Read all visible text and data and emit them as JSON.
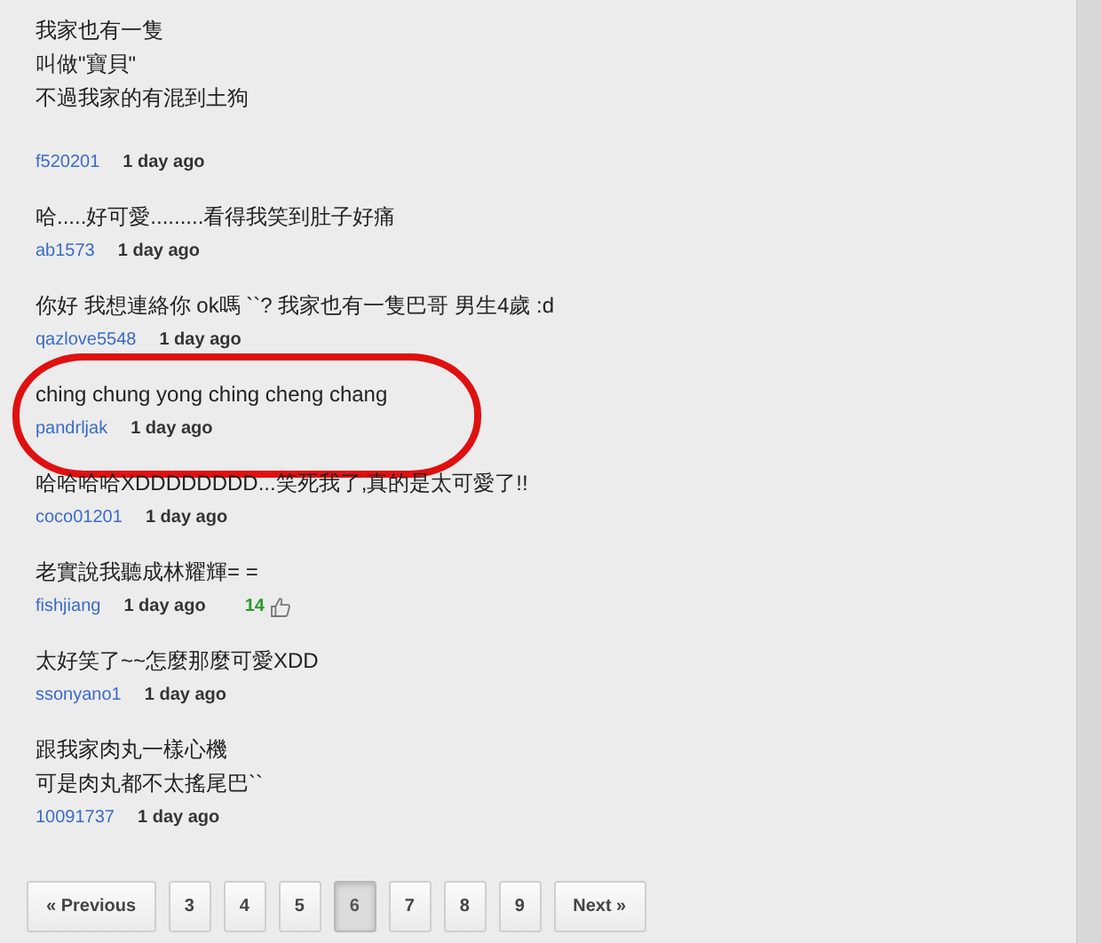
{
  "comments": [
    {
      "lines": [
        "我家也有一隻",
        "叫做\"寶貝\"",
        "不過我家的有混到土狗"
      ],
      "user": "f520201",
      "time": "1 day ago",
      "circled": false
    },
    {
      "lines": [
        "哈.....好可愛.........看得我笑到肚子好痛"
      ],
      "user": "ab1573",
      "time": "1 day ago",
      "circled": false
    },
    {
      "lines": [
        "你好 我想連絡你 ok嗎 ``? 我家也有一隻巴哥 男生4歲  :d"
      ],
      "user": "qazlove5548",
      "time": "1 day ago",
      "circled": false
    },
    {
      "lines": [
        "ching chung yong ching cheng chang"
      ],
      "user": "pandrljak",
      "time": "1 day ago",
      "circled": true
    },
    {
      "lines": [
        "哈哈哈哈XDDDDDDDD...笑死我了,真的是太可愛了!!"
      ],
      "user": "coco01201",
      "time": "1 day ago",
      "circled": false
    },
    {
      "lines": [
        "老實說我聽成林耀輝= ="
      ],
      "user": "fishjiang",
      "time": "1 day ago",
      "likes": "14",
      "circled": false
    },
    {
      "lines": [
        "太好笑了~~怎麼那麼可愛XDD"
      ],
      "user": "ssonyano1",
      "time": "1 day ago",
      "circled": false
    },
    {
      "lines": [
        "跟我家肉丸一樣心機",
        "可是肉丸都不太搖尾巴``"
      ],
      "user": "10091737",
      "time": "1 day ago",
      "circled": false
    }
  ],
  "pagination": [
    {
      "label": "« Previous",
      "selected": false
    },
    {
      "label": "3",
      "selected": false
    },
    {
      "label": "4",
      "selected": false
    },
    {
      "label": "5",
      "selected": false
    },
    {
      "label": "6",
      "selected": true
    },
    {
      "label": "7",
      "selected": false
    },
    {
      "label": "8",
      "selected": false
    },
    {
      "label": "9",
      "selected": false
    },
    {
      "label": "Next »",
      "selected": false
    }
  ]
}
